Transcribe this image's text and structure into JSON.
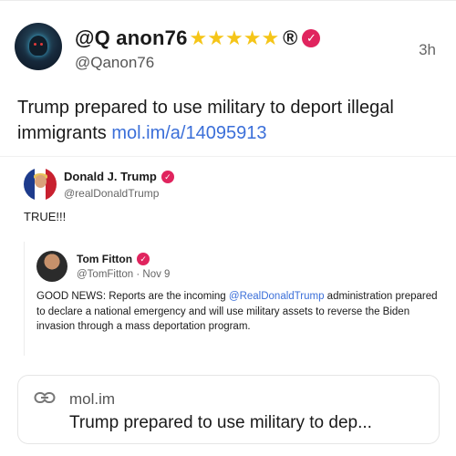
{
  "post": {
    "display_name": "@Q anon76",
    "stars": [
      "★",
      "★",
      "★",
      "★",
      "★"
    ],
    "registered_mark": "®",
    "verified_glyph": "✓",
    "handle": "@Qanon76",
    "timestamp": "3h",
    "text": "Trump prepared to use military to deport illegal immigrants ",
    "link_text": "mol.im/a/14095913"
  },
  "quoted": {
    "name": "Donald J. Trump",
    "handle": "@realDonaldTrump",
    "text": "TRUE!!!"
  },
  "nested": {
    "name": "Tom Fitton",
    "handle": "@TomFitton",
    "separator": " · ",
    "date": "Nov 9",
    "text_before": "GOOD NEWS: Reports are the incoming ",
    "mention": "@RealDonaldTrump",
    "text_after": " administration prepared to declare a national emergency and will use military assets to reverse the Biden invasion through a mass deportation program."
  },
  "link_card": {
    "icon": "link-icon",
    "domain": "mol.im",
    "title": "Trump prepared to use military to dep..."
  },
  "colors": {
    "verified_badge": "#e0245e",
    "link": "#3b6fd9",
    "stars": "#f5c518"
  }
}
